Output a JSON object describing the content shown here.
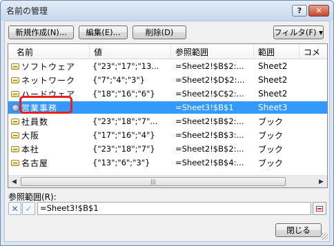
{
  "window": {
    "title": "名前の管理",
    "help_label": "?",
    "close_label": "✕"
  },
  "toolbar": {
    "new_label": "新規作成(N)...",
    "edit_label": "編集(E)...",
    "delete_label": "削除(D)",
    "filter_label": "フィルタ(F) ▾"
  },
  "columns": {
    "name": "名前",
    "value": "値",
    "ref": "参照範囲",
    "scope": "範囲",
    "comment": "コメ"
  },
  "rows": [
    {
      "name": "ソフトウェア",
      "value": "{\"23\";\"17\";\"13...",
      "ref": "=Sheet2!$B$2:...",
      "scope": "Sheet2",
      "icon": "name-icon"
    },
    {
      "name": "ネットワーク",
      "value": "{\"7\";\"4\";\"3\"}",
      "ref": "=Sheet2!$D$2:...",
      "scope": "Sheet2",
      "icon": "name-icon"
    },
    {
      "name": "ハードウェア",
      "value": "{\"18\";\"16\";\"6\"}",
      "ref": "=Sheet2!$C$2:...",
      "scope": "Sheet2",
      "icon": "name-icon"
    },
    {
      "name": "営業事務",
      "value": "",
      "ref": "=Sheet3!$B$1",
      "scope": "Sheet3",
      "icon": "scope-icon",
      "selected": true
    },
    {
      "name": "社員数",
      "value": "{\"23\";\"18\";\"7\"...",
      "ref": "=Sheet2!$B$2:...",
      "scope": "ブック",
      "icon": "name-icon"
    },
    {
      "name": "大阪",
      "value": "{\"17\";\"16\";\"4\"}",
      "ref": "=Sheet2!$B$3:...",
      "scope": "ブック",
      "icon": "name-icon"
    },
    {
      "name": "本社",
      "value": "{\"23\";\"18\";\"7\"}",
      "ref": "=Sheet2!$B$2:...",
      "scope": "ブック",
      "icon": "name-icon"
    },
    {
      "name": "名古屋",
      "value": "{\"13\";\"6\";\"3\"}",
      "ref": "=Sheet2!$B$4:...",
      "scope": "ブック",
      "icon": "name-icon"
    }
  ],
  "scrollbar": {
    "left_arrow": "◀",
    "right_arrow": "▶",
    "thumb_grip": "|||"
  },
  "reference": {
    "label": "参照範囲(R):",
    "value": "=Sheet3!$B$1",
    "cancel_icon": "✕",
    "confirm_icon": "✓"
  },
  "footer": {
    "close_label": "閉じる"
  }
}
